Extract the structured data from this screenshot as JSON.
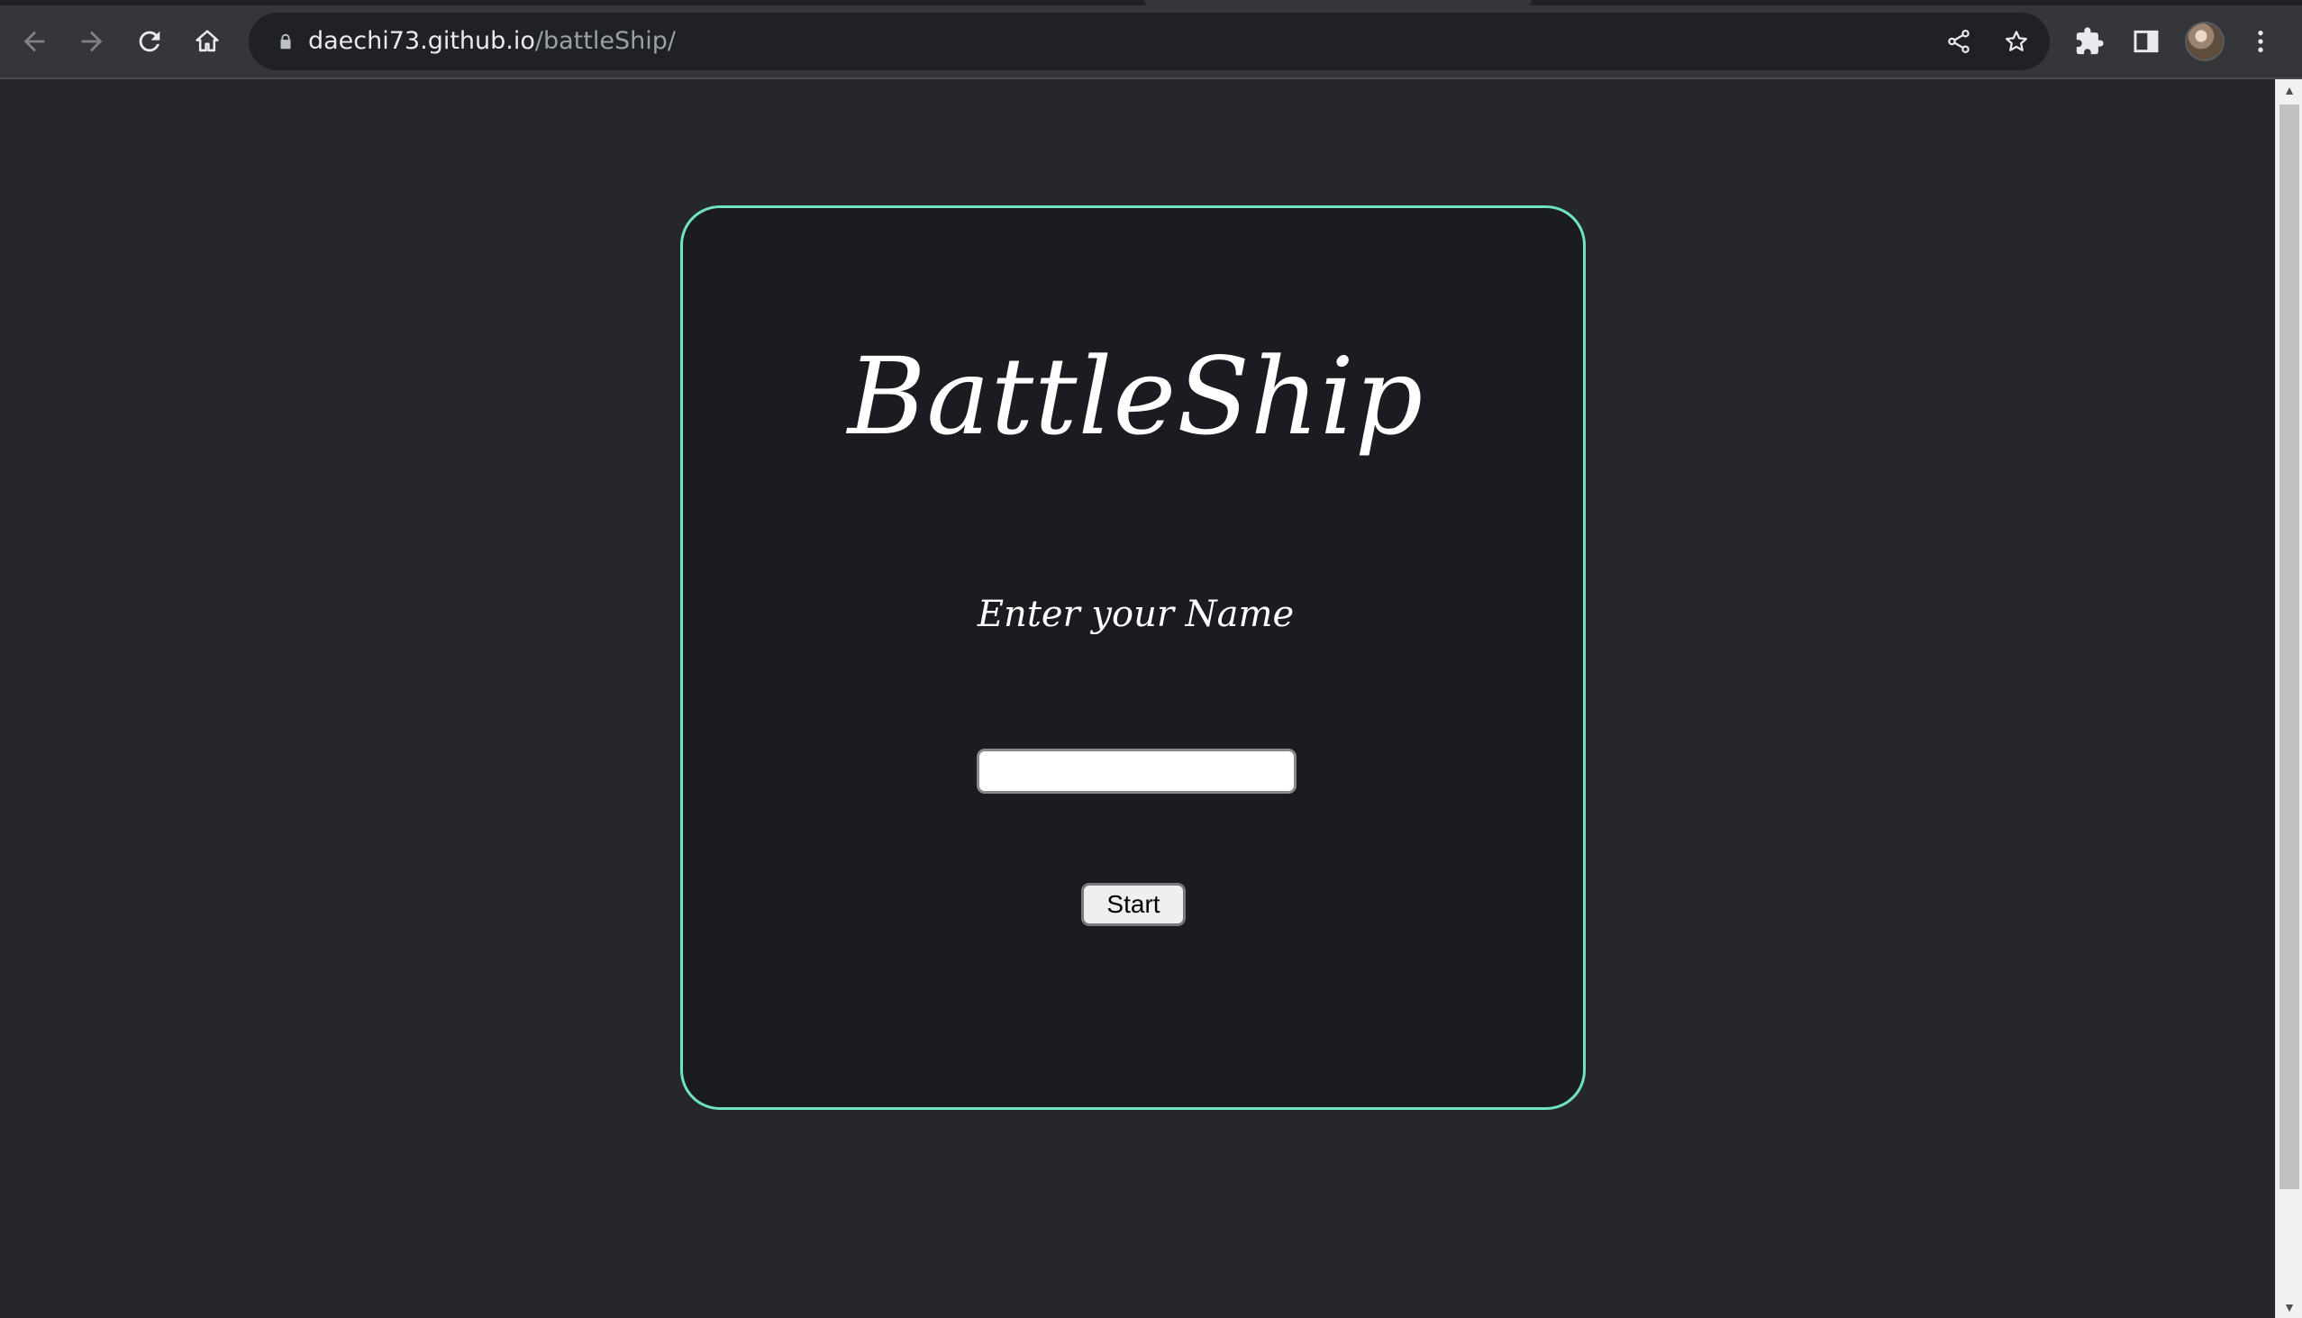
{
  "browser": {
    "url_host": "daechi73.github.io",
    "url_path": "/battleShip/",
    "icons": {
      "back": "arrow-left-icon",
      "forward": "arrow-right-icon",
      "reload": "reload-icon",
      "home": "home-icon",
      "lock": "lock-icon",
      "share": "share-icon",
      "bookmark": "star-icon",
      "extensions": "puzzle-icon",
      "side_panel": "side-panel-icon",
      "profile": "avatar",
      "menu": "kebab-menu-icon"
    }
  },
  "page": {
    "title": "BattleShip",
    "prompt": "Enter your Name",
    "name_input": {
      "value": "",
      "placeholder": ""
    },
    "start_label": "Start"
  },
  "colors": {
    "page_background": "#26272b",
    "card_background": "#1b1c22",
    "card_border": "#6fe3c3",
    "text": "#ffffff"
  }
}
